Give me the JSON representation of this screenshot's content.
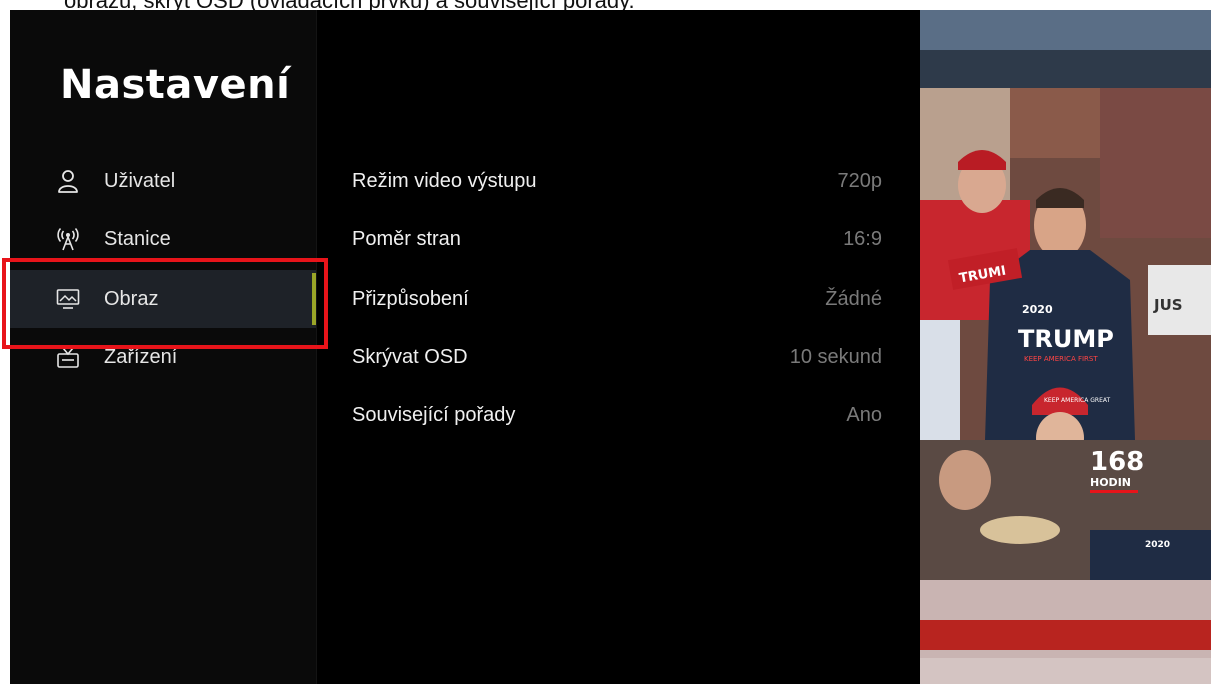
{
  "caption": "obrazu, skrýt OSD (ovládacích prvků) a související pořady.",
  "header": {
    "title": "Nastavení"
  },
  "sidebar": {
    "items": [
      {
        "label": "Uživatel",
        "icon": "user-icon"
      },
      {
        "label": "Stanice",
        "icon": "antenna-icon"
      },
      {
        "label": "Obraz",
        "icon": "monitor-icon",
        "active": true
      },
      {
        "label": "Zařízení",
        "icon": "device-icon"
      }
    ]
  },
  "settings": {
    "rows": [
      {
        "label": "Režim video výstupu",
        "value": "720p"
      },
      {
        "label": "Poměr stran",
        "value": "16:9"
      },
      {
        "label": "Přizpůsobení",
        "value": "Žádné"
      },
      {
        "label": "Skrývat OSD",
        "value": "10 sekund"
      },
      {
        "label": "Související pořady",
        "value": "Ano"
      }
    ]
  },
  "preview": {
    "sign_text": "TRUMP",
    "sign_text_short": "TRUMI",
    "banner_text": "JUS",
    "hoodie_year": "2020",
    "hoodie_sub": "KEEP AMERICA FIRST",
    "hat_text": "KEEP AMERICA GREAT",
    "channel_number": "168",
    "channel_label": "HODIN",
    "corner_text": "2020"
  },
  "colors": {
    "accent": "#9aa528",
    "highlight": "#e8141a",
    "active_bg": "#1e2228",
    "value_text": "#7a7a7a"
  }
}
